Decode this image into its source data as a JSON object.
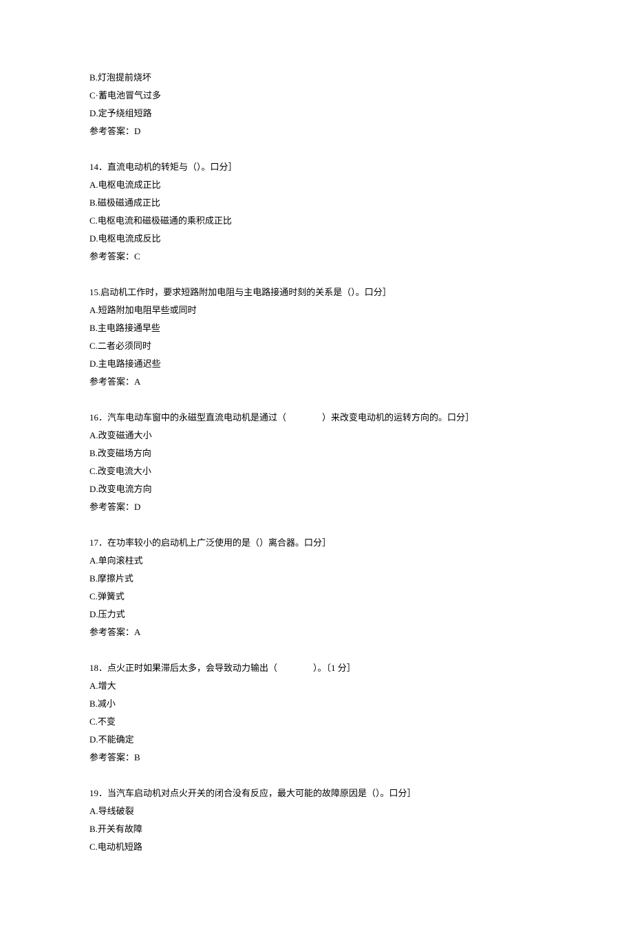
{
  "questions": [
    {
      "number": "",
      "stem": "",
      "options": [
        "B.灯泡提前烧坏",
        "C·蓄电池冒气过多",
        "D.定予绕组短路"
      ],
      "answer": "参考答案：D"
    },
    {
      "number": "14",
      "stem": "．直流电动机的转矩与（）。口分］",
      "options": [
        "A.电枢电流成正比",
        "B.磁极磁通成正比",
        "C.电枢电流和磁极磁通的乘积成正比",
        "D.电枢电流成反比"
      ],
      "answer": "参考答案：C"
    },
    {
      "number": "15.",
      "stem": "启动机工作时，要求短路附加电阻与主电路接通时刻的关系是（）。口分］",
      "options": [
        "A.短路附加电阻早些或同时",
        "B.主电路接通早些",
        "C.二者必须同时",
        "D.主电路接通迟些"
      ],
      "answer": "参考答案：A"
    },
    {
      "number": "16",
      "stem": "．汽车电动车窗中的永磁型直流电动机是通过（　　　　）来改变电动机的运转方向的。口分］",
      "options": [
        "A.改变磁通大小",
        "B.改变磁场方向",
        "C.改变电流大小",
        "D.改变电流方向"
      ],
      "answer": "参考答案：D"
    },
    {
      "number": "17",
      "stem": "．在功率较小的启动机上广泛使用的是（）离合器。口分］",
      "options": [
        "A.单向滚柱式",
        "B.摩擦片式",
        "C.弹簧式",
        "D.压力式"
      ],
      "answer": "参考答案：A"
    },
    {
      "number": "18",
      "stem": "．点火正时如果滞后太多，会导致动力输出（　　　　）。〔1 分］",
      "options": [
        "A.增大",
        "B.减小",
        "C.不变",
        "D.不能确定"
      ],
      "answer": "参考答案：B"
    },
    {
      "number": "19",
      "stem": "．当汽车启动机对点火开关的闭合没有反应，最大可能的故障原因是（）。口分］",
      "options": [
        "A.导线破裂",
        "B.开关有故障",
        "C.电动机短路"
      ],
      "answer": ""
    }
  ]
}
